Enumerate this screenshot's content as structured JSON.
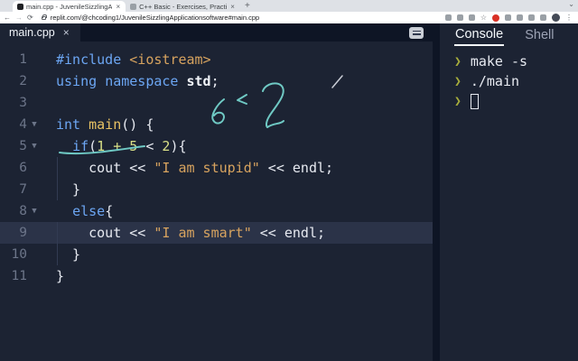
{
  "browser": {
    "tabs": [
      {
        "title": "main.cpp - JuvenileSizzlingA",
        "close_label": "×",
        "active": true
      },
      {
        "title": "C++ Basic - Exercises, Practi",
        "close_label": "×",
        "active": false
      }
    ],
    "new_tab_label": "+",
    "strip_caret": "⌄",
    "nav_back": "←",
    "nav_forward": "→",
    "nav_reload": "⟳",
    "url": "replit.com/@chcoding1/JuvenileSizzlingApplicationsoftware#main.cpp",
    "toolbar_icons": [
      "extension",
      "extension",
      "extension",
      "bookmark-star",
      "stop-red",
      "extension",
      "extension",
      "extension",
      "extension",
      "profile-avatar",
      "menu-dots"
    ]
  },
  "editor": {
    "file_tab": {
      "name": "main.cpp",
      "close_label": "×"
    },
    "fold_arrow": "▼",
    "lines": [
      {
        "num": "1",
        "fold": false,
        "segments": [
          {
            "t": "#include",
            "c": "kw"
          },
          {
            "t": " ",
            "c": "pl"
          },
          {
            "t": "<iostream>",
            "c": "str"
          }
        ]
      },
      {
        "num": "2",
        "fold": false,
        "segments": [
          {
            "t": "using",
            "c": "kw"
          },
          {
            "t": " ",
            "c": "pl"
          },
          {
            "t": "namespace",
            "c": "kw"
          },
          {
            "t": " ",
            "c": "pl"
          },
          {
            "t": "std",
            "c": "b"
          },
          {
            "t": ";",
            "c": "pl"
          }
        ]
      },
      {
        "num": "3",
        "fold": false,
        "segments": []
      },
      {
        "num": "4",
        "fold": true,
        "segments": [
          {
            "t": "int",
            "c": "kw"
          },
          {
            "t": " ",
            "c": "pl"
          },
          {
            "t": "main",
            "c": "fn"
          },
          {
            "t": "() {",
            "c": "pl"
          }
        ]
      },
      {
        "num": "5",
        "fold": true,
        "segments": [
          {
            "t": "  ",
            "c": "pl"
          },
          {
            "t": "if",
            "c": "kw"
          },
          {
            "t": "(",
            "c": "pl"
          },
          {
            "t": "1",
            "c": "num"
          },
          {
            "t": " ",
            "c": "pl"
          },
          {
            "t": "+",
            "c": "num"
          },
          {
            "t": " ",
            "c": "pl"
          },
          {
            "t": "5",
            "c": "num"
          },
          {
            "t": " < ",
            "c": "pl"
          },
          {
            "t": "2",
            "c": "num"
          },
          {
            "t": "){",
            "c": "pl"
          }
        ]
      },
      {
        "num": "6",
        "fold": false,
        "guide": true,
        "segments": [
          {
            "t": "    ",
            "c": "pl"
          },
          {
            "t": "cout",
            "c": "pl"
          },
          {
            "t": " << ",
            "c": "pl"
          },
          {
            "t": "\"I am stupid\"",
            "c": "str"
          },
          {
            "t": " << ",
            "c": "pl"
          },
          {
            "t": "endl",
            "c": "pl"
          },
          {
            "t": ";",
            "c": "pl"
          }
        ]
      },
      {
        "num": "7",
        "fold": false,
        "guide": true,
        "segments": [
          {
            "t": "  }",
            "c": "pl"
          }
        ]
      },
      {
        "num": "8",
        "fold": true,
        "segments": [
          {
            "t": "  ",
            "c": "pl"
          },
          {
            "t": "else",
            "c": "kw"
          },
          {
            "t": "{",
            "c": "pl"
          }
        ]
      },
      {
        "num": "9",
        "fold": false,
        "guide": true,
        "highlight": true,
        "segments": [
          {
            "t": "    ",
            "c": "pl"
          },
          {
            "t": "cout",
            "c": "pl"
          },
          {
            "t": " << ",
            "c": "pl"
          },
          {
            "t": "\"I am smart\"",
            "c": "str"
          },
          {
            "t": " << ",
            "c": "pl"
          },
          {
            "t": "endl",
            "c": "pl"
          },
          {
            "t": ";",
            "c": "pl"
          }
        ]
      },
      {
        "num": "10",
        "fold": false,
        "guide": true,
        "segments": [
          {
            "t": "  }",
            "c": "pl"
          }
        ]
      },
      {
        "num": "11",
        "fold": false,
        "segments": [
          {
            "t": "}",
            "c": "pl"
          }
        ]
      }
    ],
    "annotations": {
      "handwriting": "6 < 2",
      "underline_under": "1 + 5 < 2",
      "pencil_mark": "/"
    }
  },
  "console": {
    "tabs": [
      {
        "label": "Console",
        "active": true
      },
      {
        "label": "Shell",
        "active": false
      }
    ],
    "prompt_glyph": "❯",
    "lines": [
      {
        "text": "make -s"
      },
      {
        "text": "./main"
      },
      {
        "text": "",
        "cursor": true
      }
    ]
  },
  "colors": {
    "editor_bg": "#1c2333",
    "tabbar_bg": "#0e1525",
    "line_highlight": "#2b3348",
    "keyword": "#6ca6f3",
    "string": "#d7a35f",
    "number": "#d9e087",
    "function": "#e8c264",
    "plain": "#e6e9f0",
    "line_number": "#6c7589",
    "prompt": "#a8ae3c",
    "annotation_teal": "#6fc9c4",
    "console_tab_active": "#f5f9fc"
  }
}
